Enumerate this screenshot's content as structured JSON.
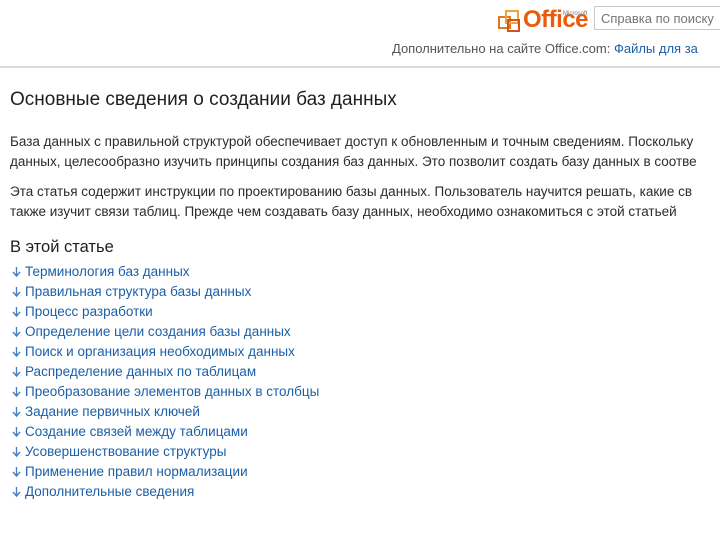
{
  "header": {
    "logo_text": "Office",
    "logo_small": "Microsoft",
    "search_placeholder": "Справка по поиску",
    "more_prefix": "Дополнительно на сайте Office.com:",
    "more_link": "Файлы для за"
  },
  "article": {
    "title": "Основные сведения о создании баз данных",
    "paragraphs": [
      [
        "База данных с правильной структурой обеспечивает доступ к обновленным и точным сведениям. Поскольку",
        "данных, целесообразно изучить принципы создания баз данных. Это позволит создать базу данных в соотве"
      ],
      [
        "Эта статья содержит инструкции по проектированию базы данных. Пользователь научится решать, какие св",
        "также изучит связи таблиц. Прежде чем создавать базу данных, необходимо ознакомиться с этой статьей"
      ]
    ],
    "toc_heading": "В этой статье",
    "toc_items": [
      "Терминология баз данных",
      "Правильная структура базы данных",
      "Процесс разработки",
      "Определение цели создания базы данных",
      "Поиск и организация необходимых данных",
      "Распределение данных по таблицам",
      "Преобразование элементов данных в столбцы",
      "Задание первичных ключей",
      "Создание связей между таблицами",
      "Усовершенствование структуры",
      "Применение правил нормализации",
      "Дополнительные сведения"
    ]
  },
  "colors": {
    "link": "#1b5fa8",
    "brand": "#ea5b0c",
    "text": "#2b2b2b",
    "icon": "#4a7fc1"
  },
  "icons": {
    "toc_item": "down-arrow-icon",
    "logo": "office-logo-icon"
  }
}
